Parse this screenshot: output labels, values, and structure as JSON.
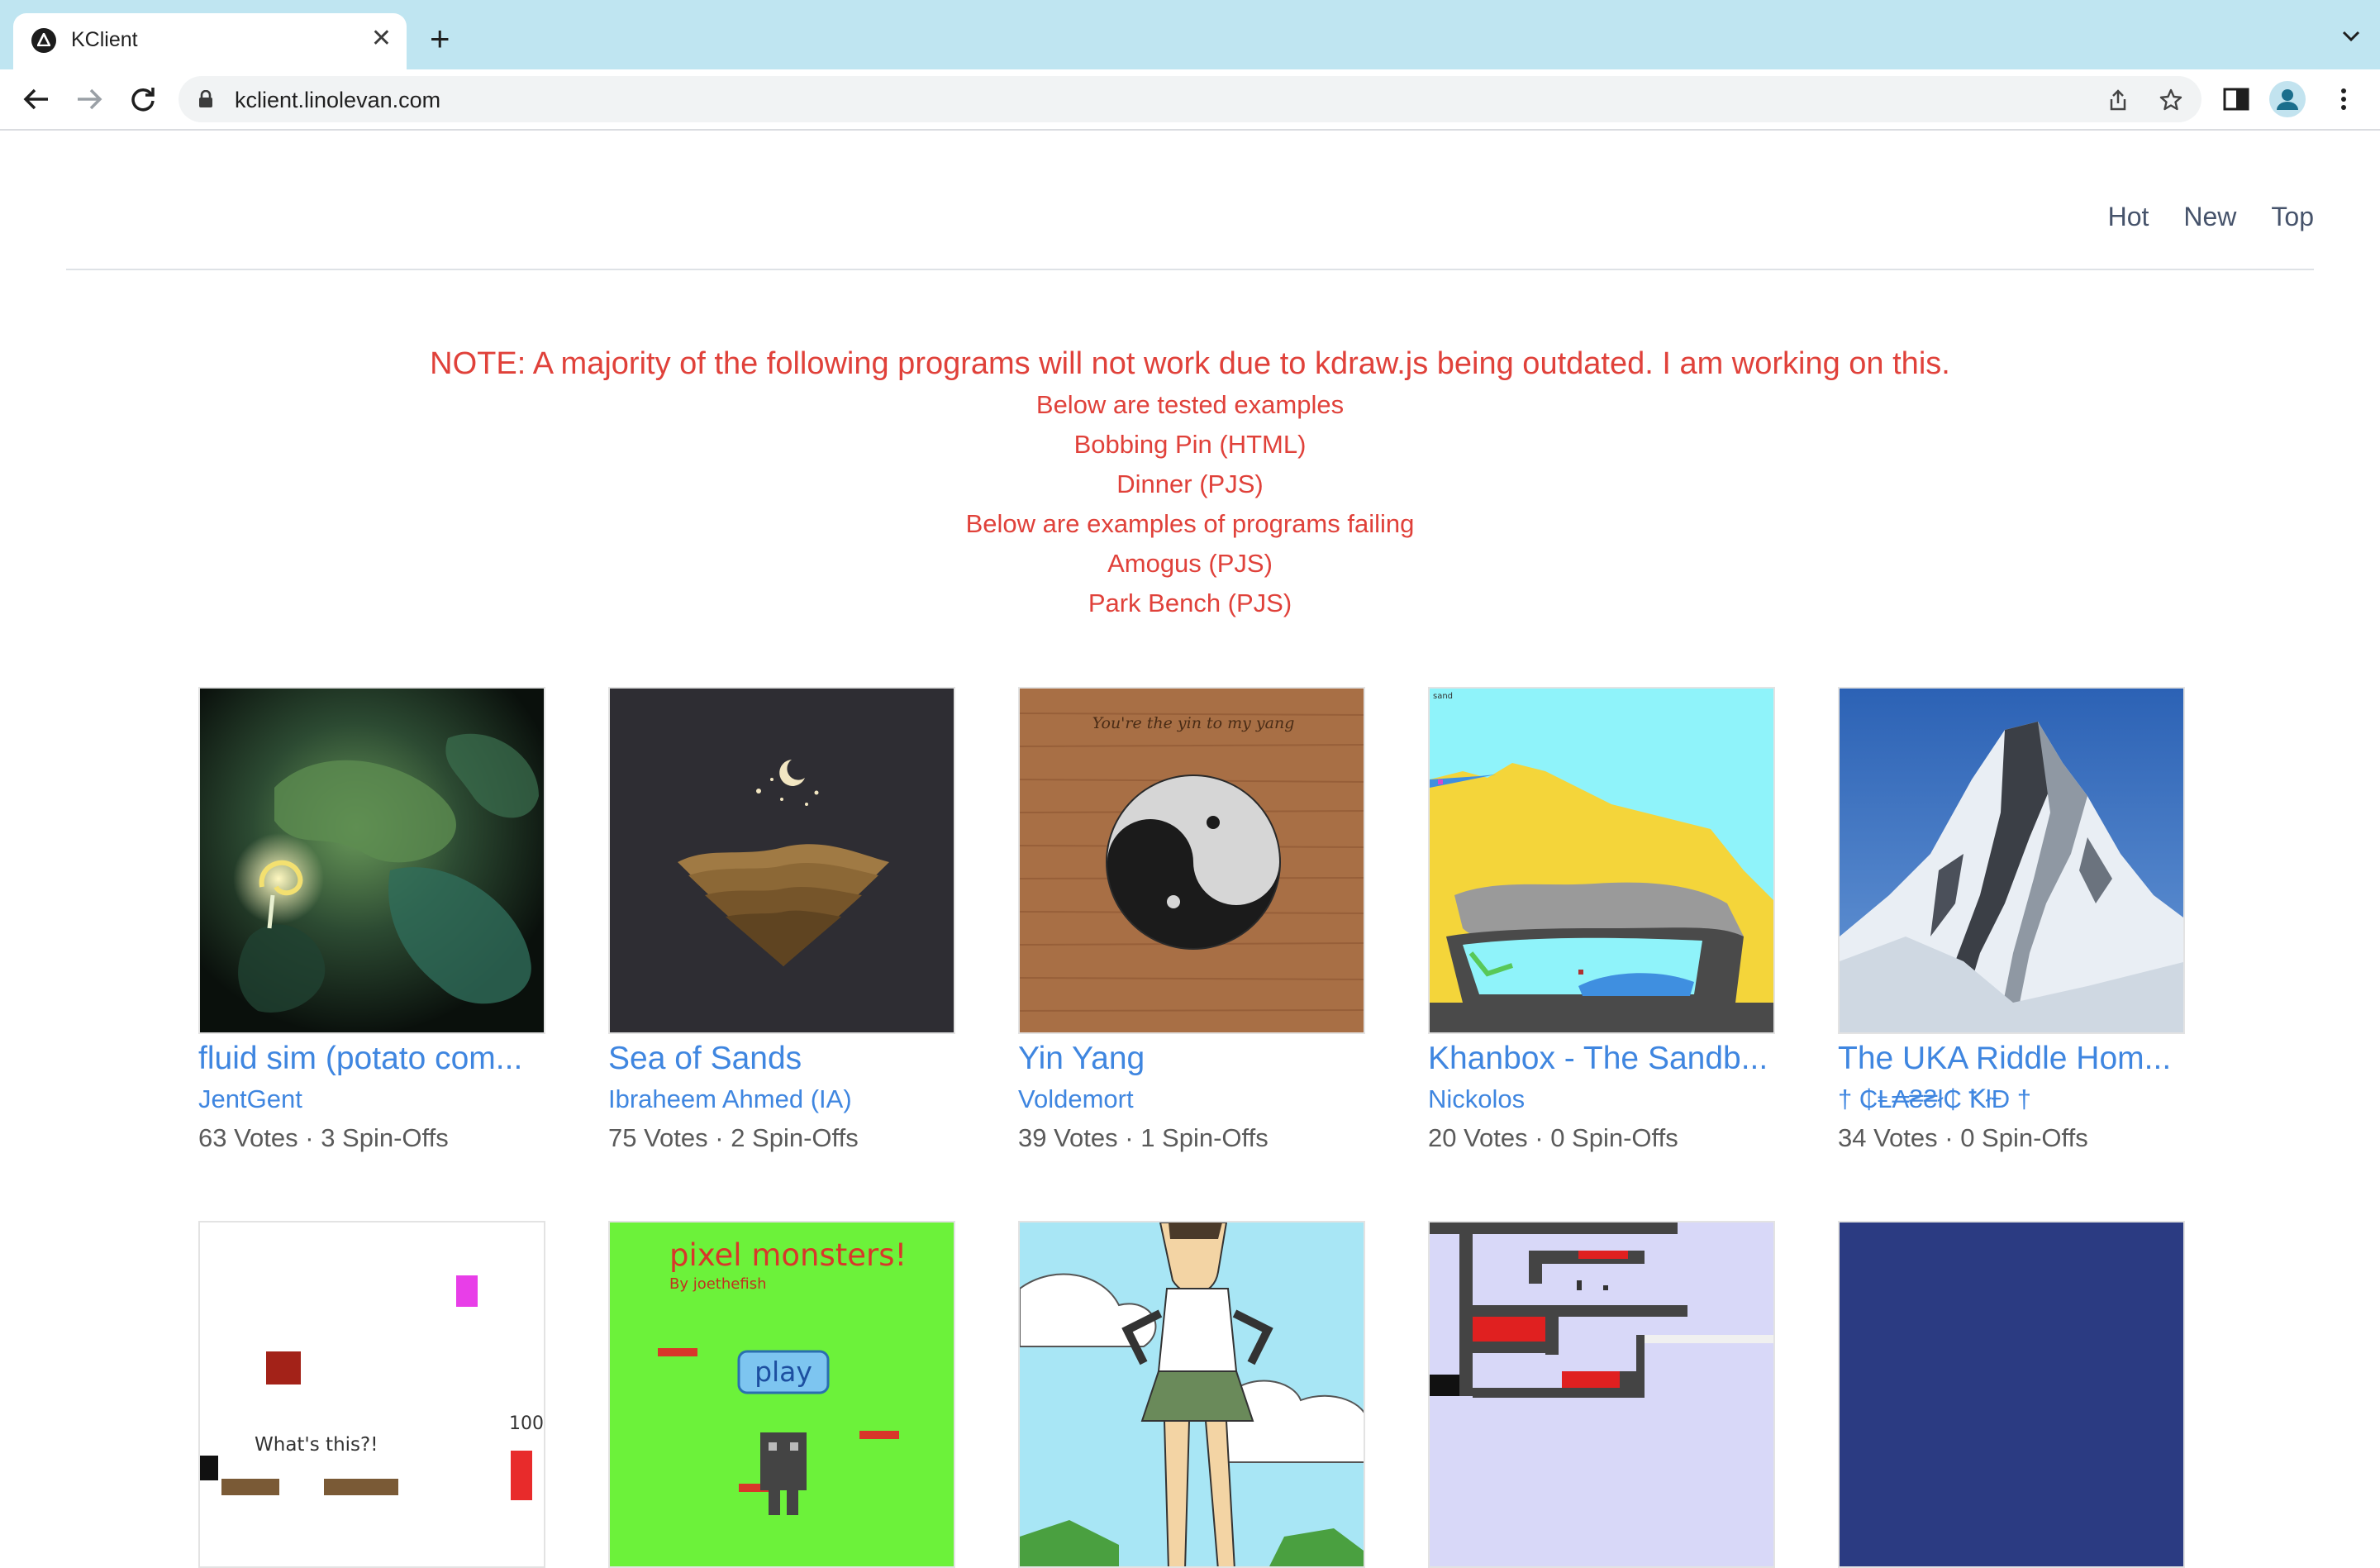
{
  "browser": {
    "tab_title": "KClient",
    "tab_close": "✕",
    "new_tab": "+",
    "url": "kclient.linolevan.com"
  },
  "nav": {
    "hot": "Hot",
    "new": "New",
    "top": "Top"
  },
  "notice": {
    "main": "NOTE: A majority of the following programs will not work due to kdraw.js being outdated. I am working on this.",
    "tested_heading": "Below are tested examples",
    "tested": [
      "Bobbing Pin (HTML)",
      "Dinner (PJS)"
    ],
    "failing_heading": "Below are examples of programs failing",
    "failing": [
      "Amogus (PJS)",
      "Park Bench (PJS)"
    ]
  },
  "programs": [
    {
      "title": "fluid sim (potato com...",
      "author": "JentGent",
      "stats": "63 Votes · 3 Spin-Offs"
    },
    {
      "title": "Sea of Sands",
      "author": "Ibraheem Ahmed (IA)",
      "stats": "75 Votes · 2 Spin-Offs"
    },
    {
      "title": "Yin Yang",
      "author": "Voldemort",
      "stats": "39 Votes · 1 Spin-Offs"
    },
    {
      "title": "Khanbox - The Sandb...",
      "author": "Nickolos",
      "stats": "20 Votes · 0 Spin-Offs"
    },
    {
      "title": "The UKA Riddle Hom...",
      "author": "† ₵Ⱡ₳₴₴ł₵ ꝀłĐ †",
      "stats": "34 Votes · 0 Spin-Offs"
    }
  ],
  "thumb_text": {
    "yinyang_caption": "You're the yin to my yang",
    "sandbox_label": "sand",
    "whats_this": "What's this?!",
    "score": "100",
    "pixel_title": "pixel monsters!",
    "pixel_byline": "By joethefish",
    "pixel_play": "play"
  },
  "colors": {
    "accent_link": "#3f86e0",
    "notice_red": "#e0413a",
    "tabbar": "#bfe5f1"
  }
}
